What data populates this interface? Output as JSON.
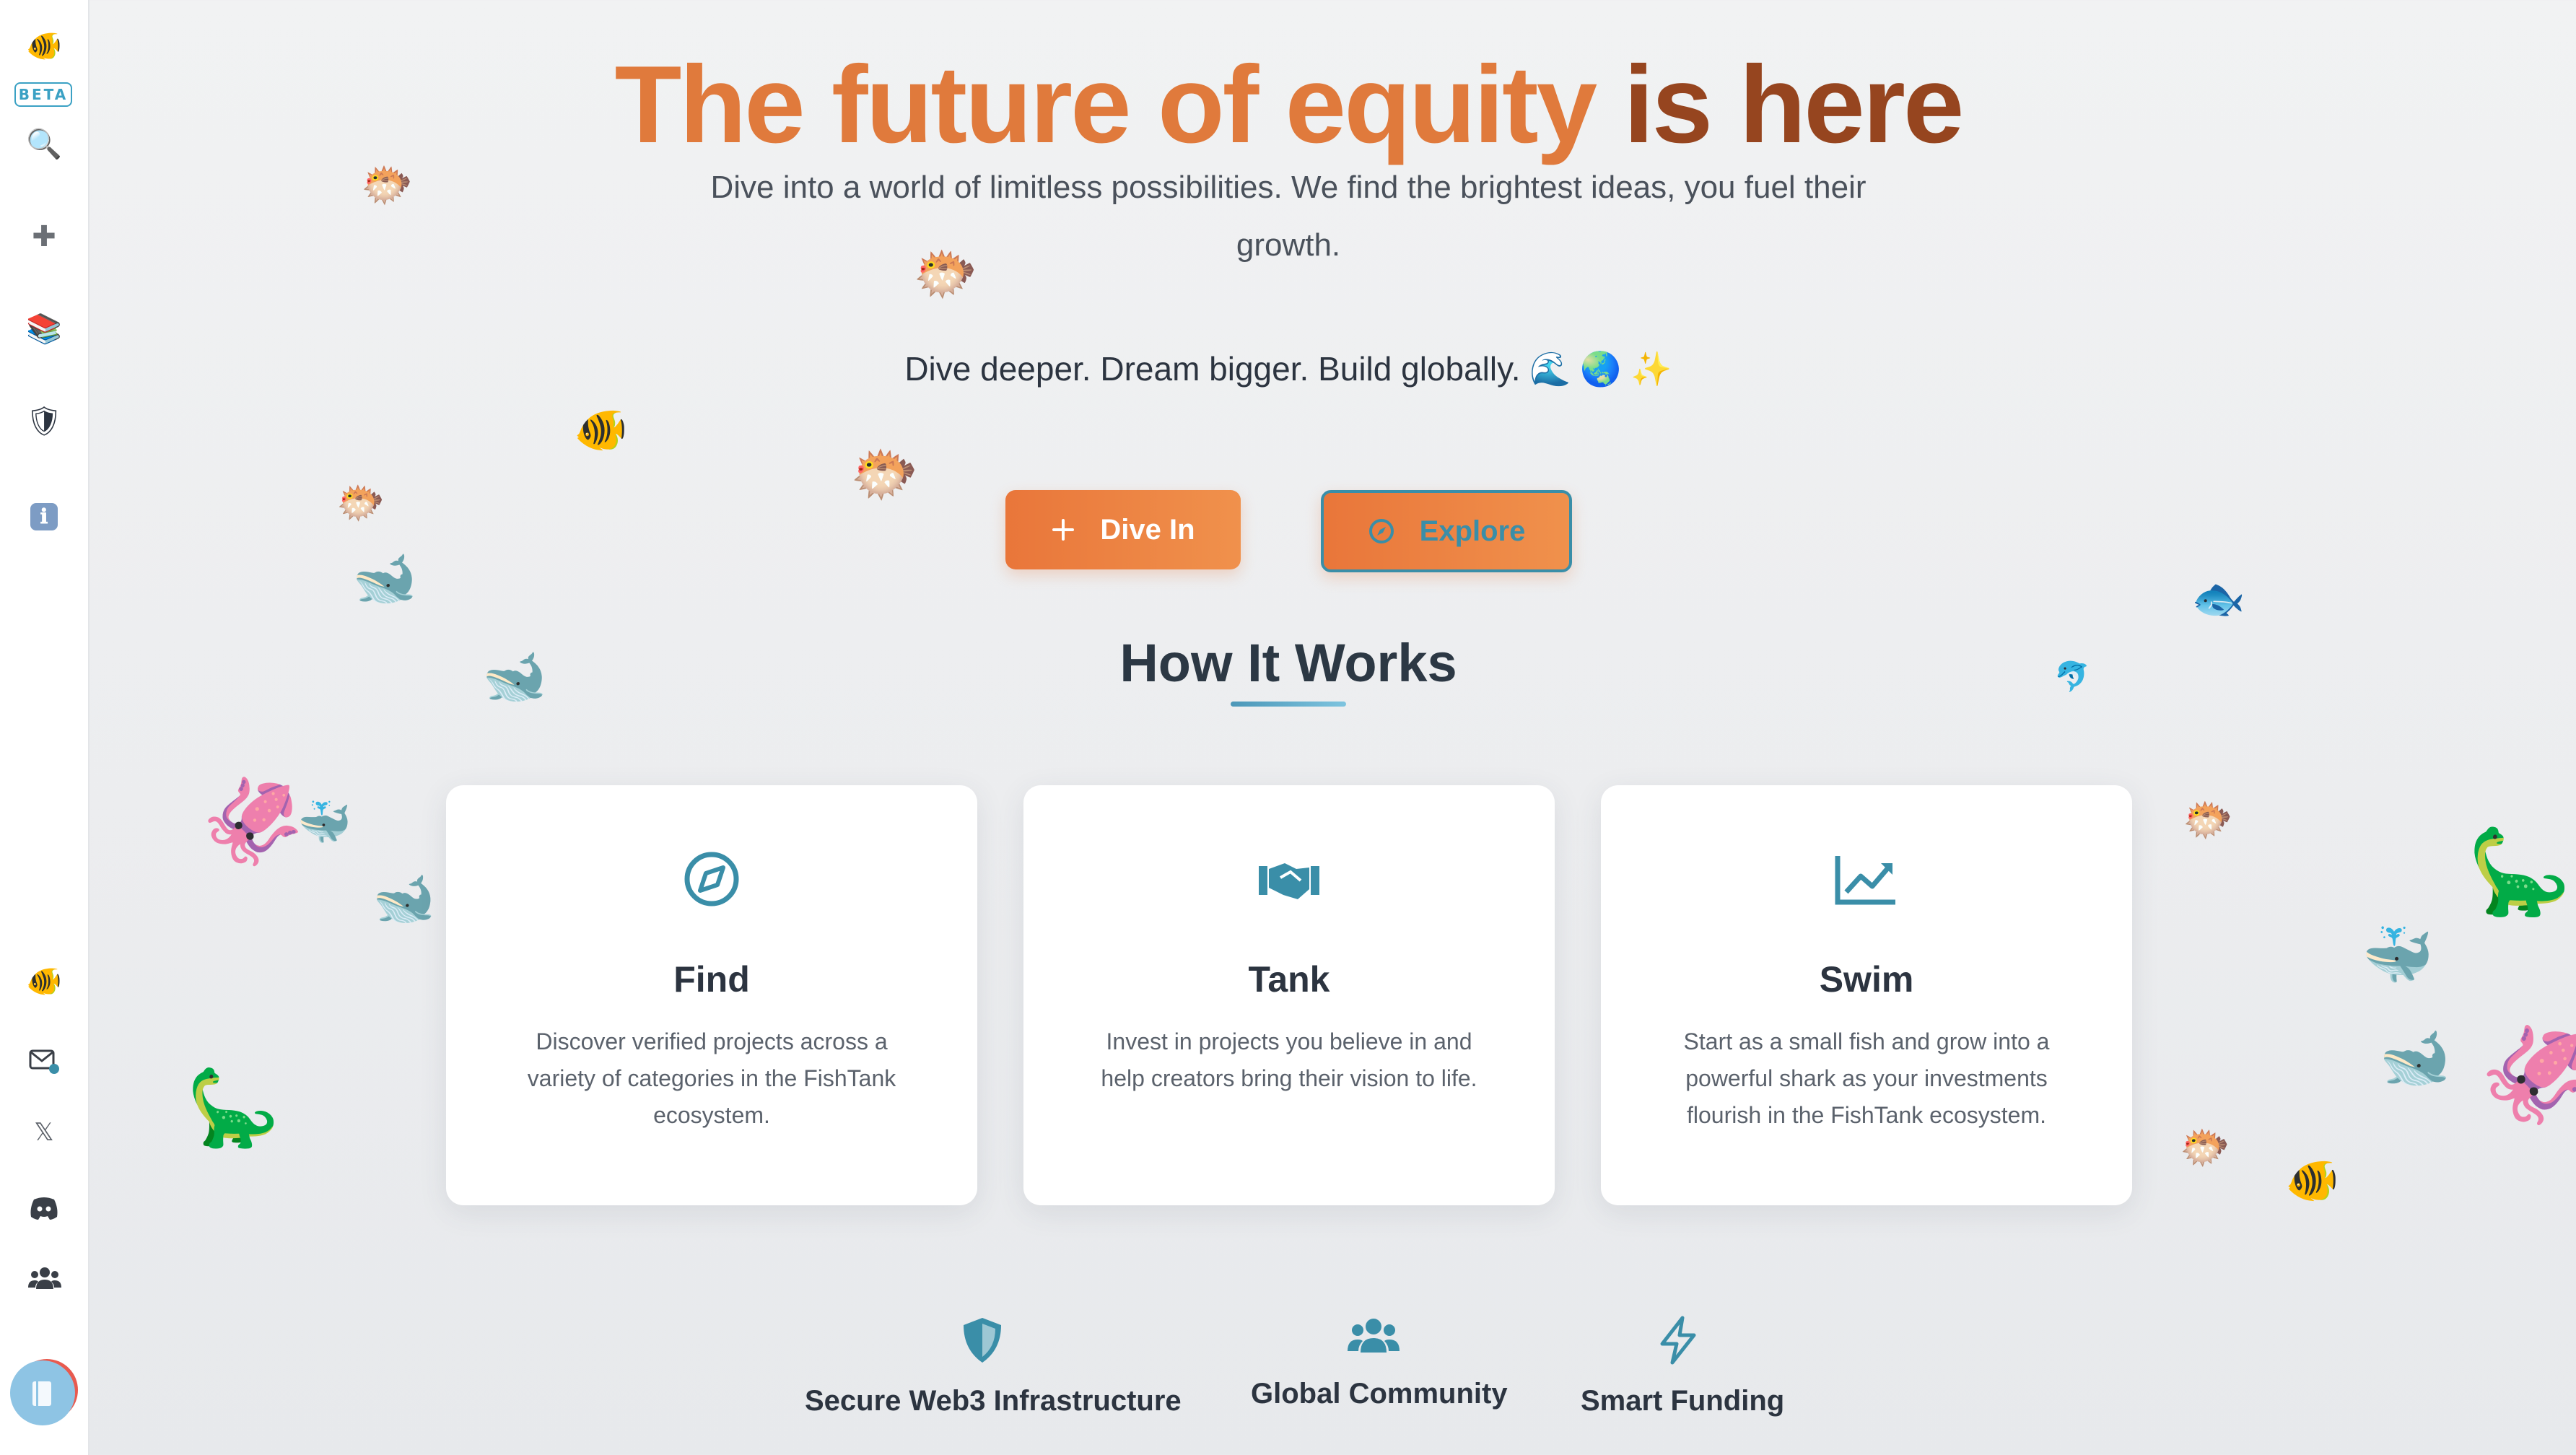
{
  "sidebar": {
    "logo_icon": "🐠",
    "beta_label": "BETA",
    "top_items": [
      {
        "name": "search",
        "icon": "🔍"
      },
      {
        "name": "add",
        "icon": "✚"
      },
      {
        "name": "library",
        "icon": "📚"
      },
      {
        "name": "shield",
        "icon": "🛡"
      },
      {
        "name": "info",
        "icon": "ℹ"
      }
    ],
    "bottom_items": [
      {
        "name": "fish",
        "icon": "🐠"
      },
      {
        "name": "mail",
        "icon": "mail"
      },
      {
        "name": "x",
        "icon": "𝕏"
      },
      {
        "name": "discord",
        "icon": "discord"
      },
      {
        "name": "community",
        "icon": "users"
      }
    ]
  },
  "hero": {
    "title_part1": "The future of equity",
    "title_part2": "is here",
    "subtitle": "Dive into a world of limitless possibilities. We find the brightest ideas, you fuel their growth.",
    "tagline": "Dive deeper. Dream bigger. Build globally. 🌊 🌏 ✨",
    "dive_in_label": "Dive In",
    "explore_label": "Explore"
  },
  "how_it_works": {
    "title": "How It Works",
    "cards": [
      {
        "icon": "compass-icon",
        "title": "Find",
        "text": "Discover verified projects across a variety of categories in the FishTank ecosystem."
      },
      {
        "icon": "handshake-icon",
        "title": "Tank",
        "text": "Invest in projects you believe in and help creators bring their vision to life."
      },
      {
        "icon": "chart-line-icon",
        "title": "Swim",
        "text": "Start as a small fish and grow into a powerful shark as your investments flourish in the FishTank ecosystem."
      }
    ]
  },
  "features": [
    {
      "icon": "shield-icon",
      "label": "Secure Web3 Infrastructure"
    },
    {
      "icon": "users-icon",
      "label": "Global Community"
    },
    {
      "icon": "bolt-icon",
      "label": "Smart Funding"
    }
  ],
  "decorations": {
    "blowfish": "🐡",
    "tropical_fish": "🐠",
    "fish": "🐟",
    "whale": "🐋",
    "spouting_whale": "🐳",
    "dolphin": "🐬",
    "squid": "🦑",
    "sauropod": "🦕"
  },
  "colors": {
    "accent_orange": "#e9763a",
    "title_dark": "#96451f",
    "teal": "#3a8ea8"
  }
}
